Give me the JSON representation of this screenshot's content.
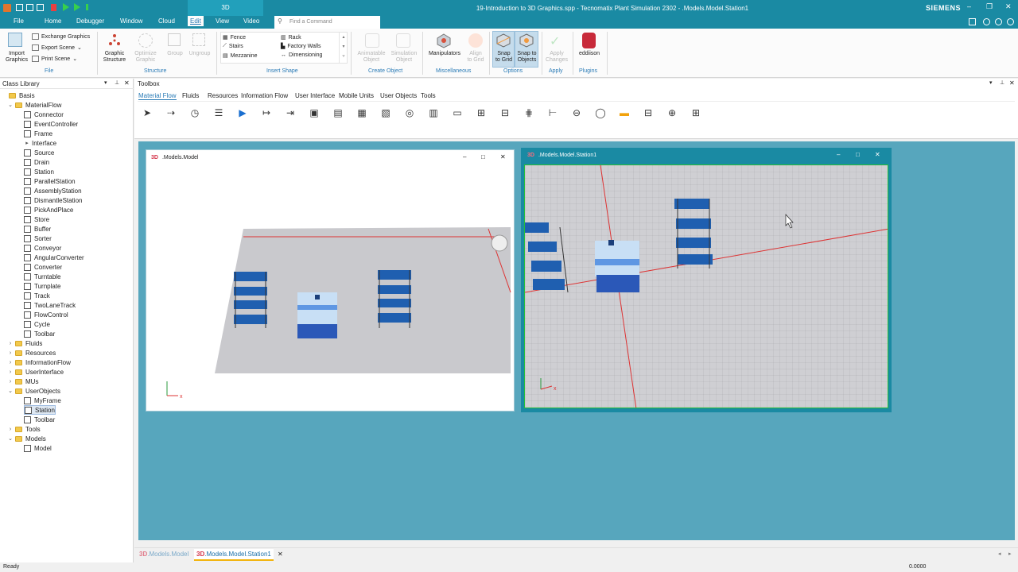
{
  "title_bar": {
    "context_tab": "3D",
    "title": "19-Introduction to 3D Graphics.spp - Tecnomatix Plant Simulation 2302 - .Models.Model.Station1",
    "brand": "SIEMENS"
  },
  "menu": {
    "items": [
      "File",
      "Home",
      "Debugger",
      "Window",
      "Cloud",
      "Edit",
      "View",
      "Video"
    ],
    "active": "Edit",
    "search_placeholder": "Find a Command"
  },
  "ribbon": {
    "import_graphics": "Import\nGraphics",
    "exchange_graphics": "Exchange Graphics",
    "export_scene": "Export Scene",
    "print_scene": "Print Scene",
    "graphic_structure": "Graphic\nStructure",
    "optimize_graphic": "Optimize\nGraphic",
    "group": "Group",
    "ungroup": "Ungroup",
    "fence": "Fence",
    "stairs": "Stairs",
    "mezzanine": "Mezzanine",
    "rack": "Rack",
    "factory_walls": "Factory Walls",
    "dimensioning": "Dimensioning",
    "animatable_object": "Animatable\nObject",
    "simulation_object": "Simulation\nObject",
    "manipulators": "Manipulators",
    "align_to_grid": "Align\nto Grid",
    "snap_to_grid": "Snap\nto Grid",
    "snap_to_objects": "Snap to\nObjects",
    "apply_changes": "Apply\nChanges",
    "eddiison": "eddiison",
    "groups": [
      "File",
      "Structure",
      "Insert Shape",
      "Create Object",
      "Miscellaneous",
      "Options",
      "Apply",
      "Plugins"
    ]
  },
  "class_library": {
    "title": "Class Library",
    "rows": [
      {
        "label": "Basis",
        "level": 0,
        "type": "root"
      },
      {
        "label": "MaterialFlow",
        "level": 1,
        "type": "folder",
        "exp": "open"
      },
      {
        "label": "Connector",
        "level": 2,
        "type": "item"
      },
      {
        "label": "EventController",
        "level": 2,
        "type": "item"
      },
      {
        "label": "Frame",
        "level": 2,
        "type": "item"
      },
      {
        "label": "Interface",
        "level": 2,
        "type": "item-arrow"
      },
      {
        "label": "Source",
        "level": 2,
        "type": "item"
      },
      {
        "label": "Drain",
        "level": 2,
        "type": "item"
      },
      {
        "label": "Station",
        "level": 2,
        "type": "item"
      },
      {
        "label": "ParallelStation",
        "level": 2,
        "type": "item"
      },
      {
        "label": "AssemblyStation",
        "level": 2,
        "type": "item"
      },
      {
        "label": "DismantleStation",
        "level": 2,
        "type": "item"
      },
      {
        "label": "PickAndPlace",
        "level": 2,
        "type": "item"
      },
      {
        "label": "Store",
        "level": 2,
        "type": "item"
      },
      {
        "label": "Buffer",
        "level": 2,
        "type": "item"
      },
      {
        "label": "Sorter",
        "level": 2,
        "type": "item"
      },
      {
        "label": "Conveyor",
        "level": 2,
        "type": "item"
      },
      {
        "label": "AngularConverter",
        "level": 2,
        "type": "item"
      },
      {
        "label": "Converter",
        "level": 2,
        "type": "item"
      },
      {
        "label": "Turntable",
        "level": 2,
        "type": "item"
      },
      {
        "label": "Turnplate",
        "level": 2,
        "type": "item"
      },
      {
        "label": "Track",
        "level": 2,
        "type": "item"
      },
      {
        "label": "TwoLaneTrack",
        "level": 2,
        "type": "item"
      },
      {
        "label": "FlowControl",
        "level": 2,
        "type": "item"
      },
      {
        "label": "Cycle",
        "level": 2,
        "type": "item"
      },
      {
        "label": "Toolbar",
        "level": 2,
        "type": "item"
      },
      {
        "label": "Fluids",
        "level": 1,
        "type": "folder",
        "exp": "closed"
      },
      {
        "label": "Resources",
        "level": 1,
        "type": "folder",
        "exp": "closed"
      },
      {
        "label": "InformationFlow",
        "level": 1,
        "type": "folder",
        "exp": "closed"
      },
      {
        "label": "UserInterface",
        "level": 1,
        "type": "folder",
        "exp": "closed"
      },
      {
        "label": "MUs",
        "level": 1,
        "type": "folder",
        "exp": "closed"
      },
      {
        "label": "UserObjects",
        "level": 1,
        "type": "folder",
        "exp": "open"
      },
      {
        "label": "MyFrame",
        "level": 2,
        "type": "item"
      },
      {
        "label": "Station",
        "level": 2,
        "type": "item",
        "selected": true
      },
      {
        "label": "Toolbar",
        "level": 2,
        "type": "item"
      },
      {
        "label": "Tools",
        "level": 1,
        "type": "folder",
        "exp": "closed"
      },
      {
        "label": "Models",
        "level": 1,
        "type": "folder",
        "exp": "open"
      },
      {
        "label": "Model",
        "level": 2,
        "type": "item"
      }
    ]
  },
  "toolbox": {
    "title": "Toolbox",
    "tabs": [
      "Material Flow",
      "Fluids",
      "Resources",
      "Information Flow",
      "User Interface",
      "Mobile Units",
      "User Objects",
      "Tools"
    ],
    "active_tab": "Material Flow"
  },
  "windows": {
    "model": {
      "badge": "3D",
      "title": ".Models.Model"
    },
    "station": {
      "badge": "3D",
      "title": ".Models.Model.Station1"
    }
  },
  "doc_tabs": [
    {
      "badge": "3D",
      "label": ".Models.Model"
    },
    {
      "badge": "3D",
      "label": ".Models.Model.Station1"
    }
  ],
  "status": {
    "left": "Ready",
    "right": "0.0000"
  },
  "axis_label": "x",
  "colors": {
    "brand": "#1a8aa3",
    "accent_blue": "#2a7bb6",
    "workspace": "#57a6bd",
    "active_border": "#22c03a"
  }
}
